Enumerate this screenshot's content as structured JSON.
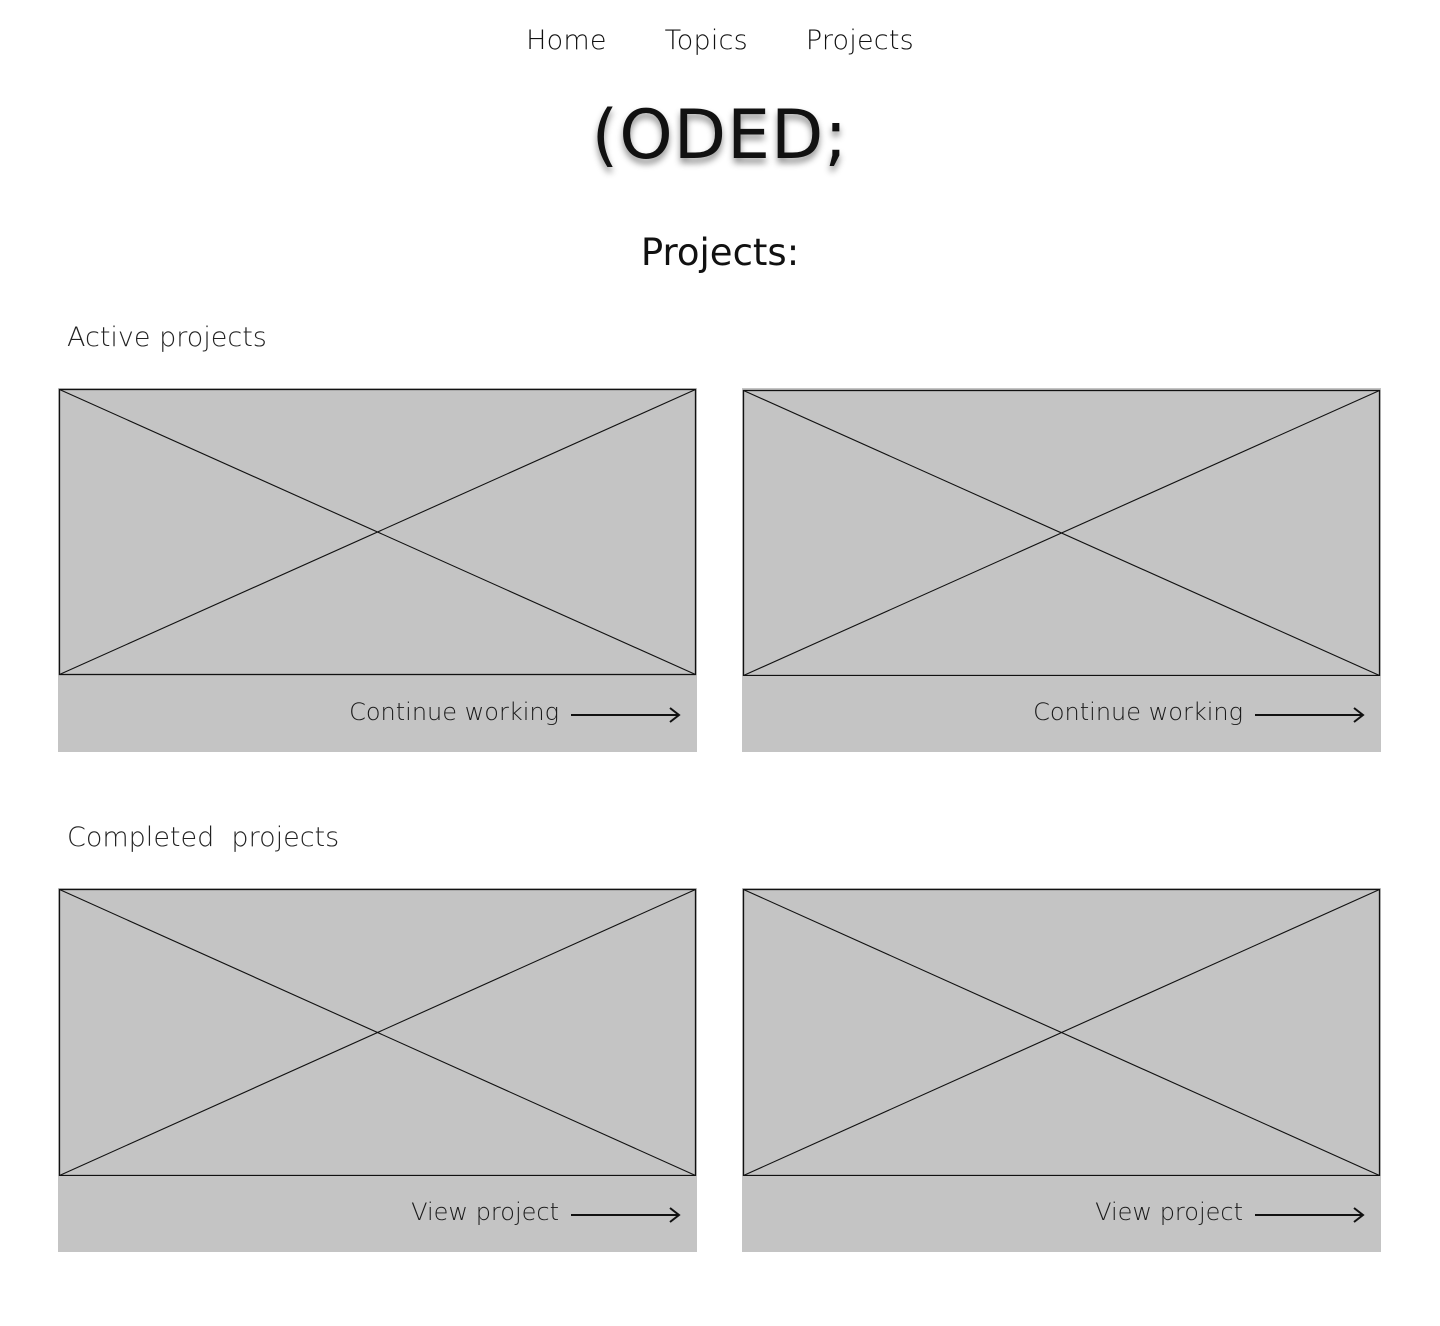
{
  "nav": {
    "items": [
      {
        "label": "Home"
      },
      {
        "label": "Topics"
      },
      {
        "label": "Projects"
      }
    ]
  },
  "brand": {
    "logo_text": "(ODED;"
  },
  "page": {
    "title": "Projects:"
  },
  "sections": {
    "active": {
      "heading": "Active projects",
      "cards": [
        {
          "action_label": "Continue working",
          "image": "image-placeholder",
          "icon": "arrow-right-icon"
        },
        {
          "action_label": "Continue working",
          "image": "image-placeholder",
          "icon": "arrow-right-icon"
        }
      ]
    },
    "completed": {
      "heading": "Completed  projects",
      "cards": [
        {
          "action_label": "View project",
          "image": "image-placeholder",
          "icon": "arrow-right-icon"
        },
        {
          "action_label": "View project",
          "image": "image-placeholder",
          "icon": "arrow-right-icon"
        }
      ]
    }
  },
  "colors": {
    "card_background": "#c4c4c4",
    "page_background": "#ffffff",
    "text": "#111111"
  }
}
